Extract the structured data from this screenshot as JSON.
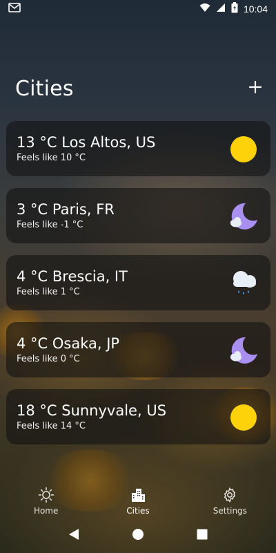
{
  "status_bar": {
    "time": "10:04",
    "icons": [
      "gmail-icon",
      "wifi-icon",
      "signal-icon",
      "battery-charging-icon"
    ]
  },
  "header": {
    "title": "Cities",
    "add_icon": "plus-icon"
  },
  "cities": [
    {
      "main": "13 °C Los Altos, US",
      "feels": "Feels like 10 °C",
      "icon": "sun-icon"
    },
    {
      "main": "3 °C Paris, FR",
      "feels": "Feels like -1 °C",
      "icon": "moon-cloud-icon"
    },
    {
      "main": "4 °C Brescia, IT",
      "feels": "Feels like 1 °C",
      "icon": "rain-cloud-icon"
    },
    {
      "main": "4 °C Osaka, JP",
      "feels": "Feels like 0 °C",
      "icon": "moon-cloud-icon"
    },
    {
      "main": "18 °C Sunnyvale, US",
      "feels": "Feels like 14 °C",
      "icon": "sun-icon"
    }
  ],
  "bottom_nav": [
    {
      "label": "Home",
      "icon": "sun-outline-icon",
      "active": false
    },
    {
      "label": "Cities",
      "icon": "buildings-icon",
      "active": true
    },
    {
      "label": "Settings",
      "icon": "gear-icon",
      "active": false
    }
  ],
  "system_nav": [
    "back-icon",
    "home-circle-icon",
    "recents-square-icon"
  ],
  "colors": {
    "sun": "#fdd20b",
    "moon": "#a88ff0",
    "cloud": "#e8eef5",
    "card_bg": "rgba(20,20,20,0.62)",
    "text": "#ffffff"
  }
}
